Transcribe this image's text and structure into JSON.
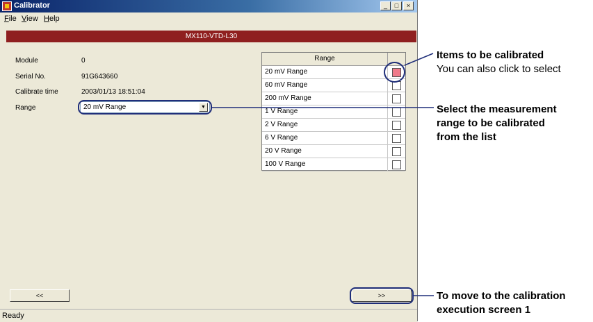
{
  "window": {
    "title": "Calibrator",
    "buttons": {
      "minimize": "_",
      "maximize": "□",
      "close": "×"
    }
  },
  "menu": [
    "File",
    "View",
    "Help"
  ],
  "module_banner": "MX110-VTD-L30",
  "fields": {
    "module": {
      "label": "Module",
      "value": "0"
    },
    "serial": {
      "label": "Serial No.",
      "value": "91G643660"
    },
    "calibrate_time": {
      "label": "Calibrate time",
      "value": "2003/01/13 18:51:04"
    },
    "range": {
      "label": "Range",
      "selected": "20 mV Range"
    }
  },
  "range_table": {
    "header": "Range",
    "rows": [
      {
        "label": "20 mV Range",
        "checked": true
      },
      {
        "label": "60 mV Range",
        "checked": false
      },
      {
        "label": "200 mV Range",
        "checked": false
      },
      {
        "label": "1 V Range",
        "checked": false
      },
      {
        "label": "2 V Range",
        "checked": false
      },
      {
        "label": "6 V Range",
        "checked": false
      },
      {
        "label": "20 V Range",
        "checked": false
      },
      {
        "label": "100 V Range",
        "checked": false
      }
    ]
  },
  "nav": {
    "prev": "<<",
    "next": ">>"
  },
  "status": "Ready",
  "annotations": {
    "items_title": "Items to be calibrated",
    "items_sub": "You can also click to select",
    "select_line1": "Select the measurement",
    "select_line2": "range to be calibrated",
    "select_line3": "from the list",
    "move_line1": "To move to the calibration",
    "move_line2": "execution screen 1"
  },
  "colors": {
    "banner": "#8f1f1f",
    "checked": "#f07a8a",
    "annotation": "#1f2e7a"
  }
}
